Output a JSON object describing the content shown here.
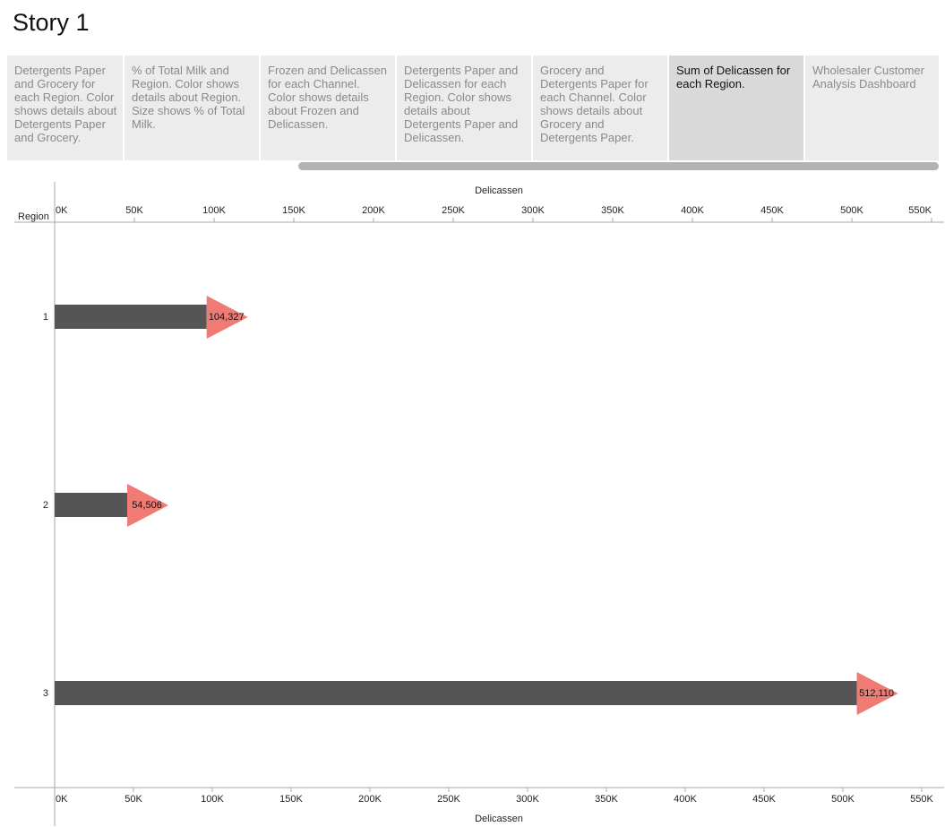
{
  "story": {
    "title": "Story 1"
  },
  "tabs": [
    {
      "label": "Detergents Paper and Grocery for each Region. Color shows details about Detergents Paper and Grocery.",
      "selected": false
    },
    {
      "label": "% of Total Milk and Region. Color shows details about Region. Size shows % of Total Milk.",
      "selected": false
    },
    {
      "label": "Frozen and Delicassen for each Channel. Color shows details about Frozen and Delicassen.",
      "selected": false
    },
    {
      "label": "Detergents Paper and Delicassen for each Region. Color shows details about Detergents Paper and Delicassen.",
      "selected": false
    },
    {
      "label": "Grocery and Detergents Paper for each Channel. Color shows details about Grocery and Detergents Paper.",
      "selected": false
    },
    {
      "label": "Sum of Delicassen for each Region.",
      "selected": true
    },
    {
      "label": "Wholesaler Customer Analysis Dashboard",
      "selected": false
    }
  ],
  "colors": {
    "bar": "#555555",
    "marker": "#f07b75",
    "axis": "#aaaaaa",
    "tab_bg": "#ececec",
    "tab_selected_bg": "#d9d9d9"
  },
  "chart_data": {
    "type": "bar",
    "orientation": "horizontal",
    "title": "",
    "xlabel": "Delicassen",
    "ylabel": "Region",
    "categories": [
      "1",
      "2",
      "3"
    ],
    "values": [
      104327,
      54506,
      512110
    ],
    "value_labels": [
      "104,327",
      "54,506",
      "512,110"
    ],
    "top_ticks": [
      "0K",
      "50K",
      "100K",
      "150K",
      "200K",
      "250K",
      "300K",
      "350K",
      "400K",
      "450K",
      "500K",
      "550K"
    ],
    "top_xlim": [
      0,
      550000
    ],
    "bottom_ticks": [
      "0K",
      "50K",
      "100K",
      "150K",
      "200K",
      "250K",
      "300K",
      "350K",
      "400K",
      "450K",
      "500K",
      "550K"
    ],
    "bottom_xlim": [
      0,
      550000
    ],
    "marker": "triangle-right",
    "grid": false
  }
}
